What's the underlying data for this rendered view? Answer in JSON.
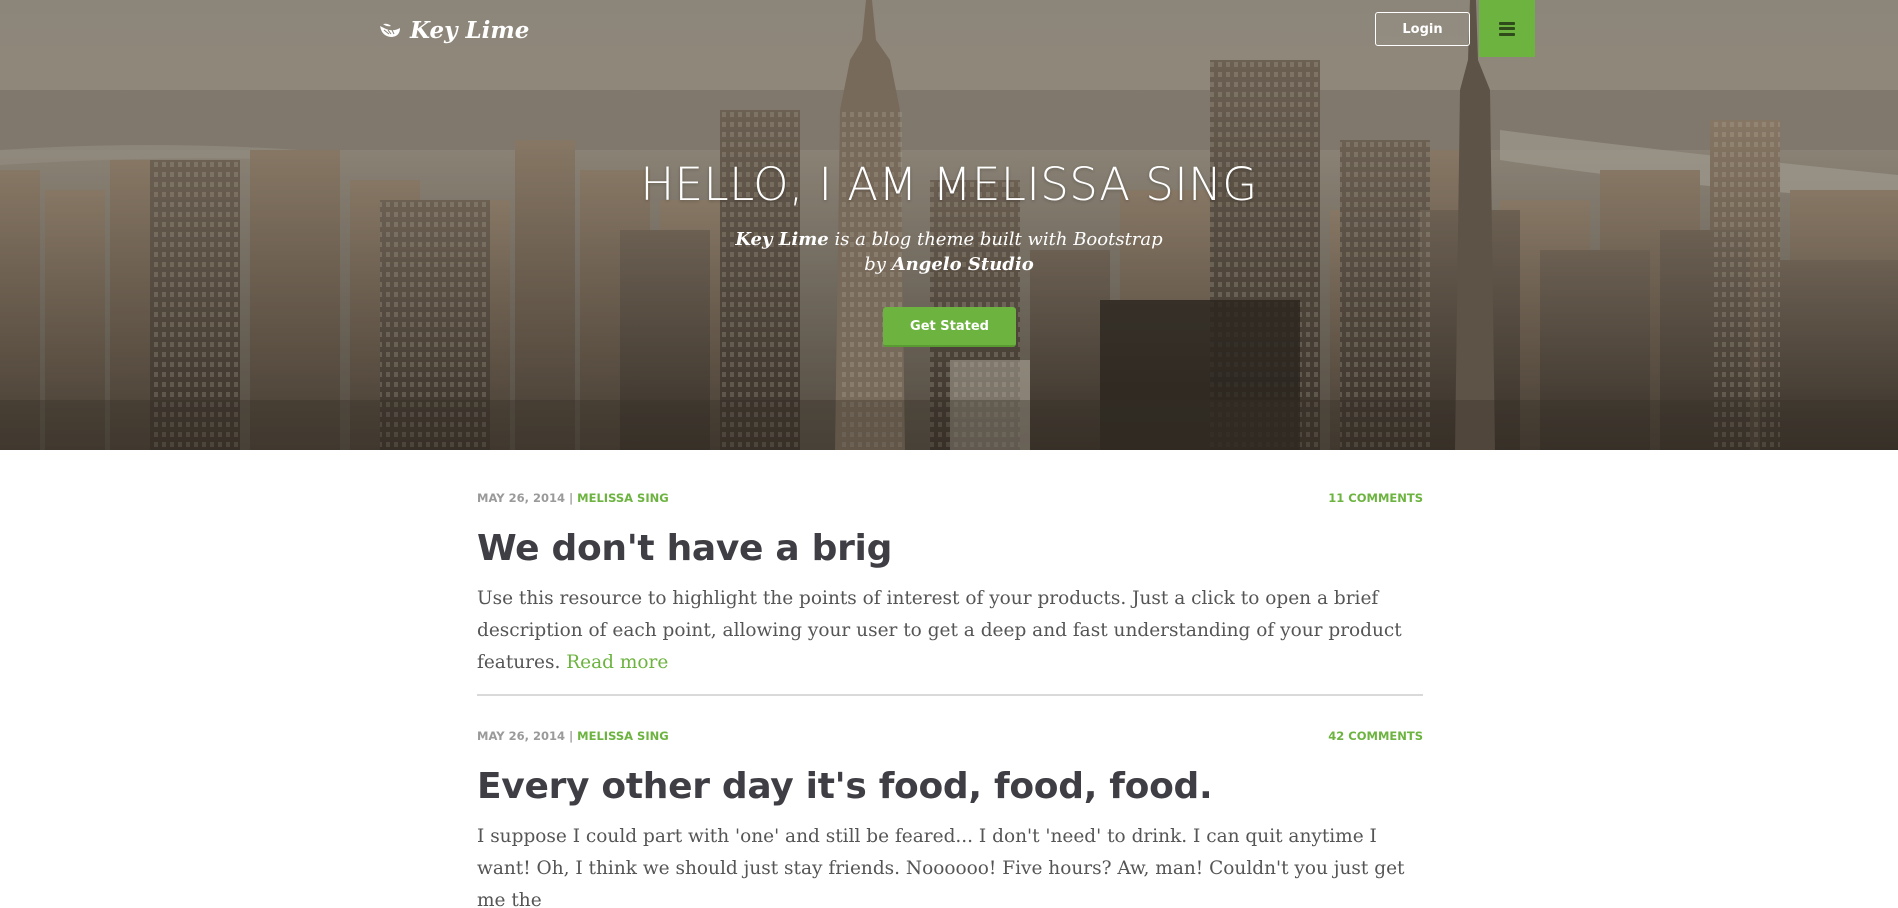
{
  "header": {
    "brand": "Key Lime",
    "login_label": "Login",
    "menu_icon": "hamburger-icon"
  },
  "hero": {
    "title": "HELLO, I AM MELISSA SING",
    "subtitle_brand": "Key Lime",
    "subtitle_rest": " is a blog theme built with Bootstrap",
    "subtitle_line2_prefix": "by ",
    "subtitle_line2_author": "Angelo Studio",
    "cta_label": "Get Stated"
  },
  "colors": {
    "accent": "#6cb33f",
    "title": "#3e3e44",
    "body_text": "#555555",
    "meta_gray": "#9a9a9a"
  },
  "posts": [
    {
      "date": "MAY 26, 2014",
      "separator": "|",
      "author": "MELISSA SING",
      "comments": "11 COMMENTS",
      "title": "We don't have a brig",
      "excerpt": "Use this resource to highlight the points of interest of your products. Just a click to open a brief description of each point, allowing your user to get a deep and fast understanding of your product features.",
      "read_more": "Read more"
    },
    {
      "date": "MAY 26, 2014",
      "separator": "|",
      "author": "MELISSA SING",
      "comments": "42 COMMENTS",
      "title": "Every other day it's food, food, food.",
      "excerpt": "I suppose I could part with 'one' and still be feared... I don't 'need' to drink. I can quit anytime I want! Oh, I think we should just stay friends. Noooooo! Five hours? Aw, man! Couldn't you just get me the"
    }
  ]
}
